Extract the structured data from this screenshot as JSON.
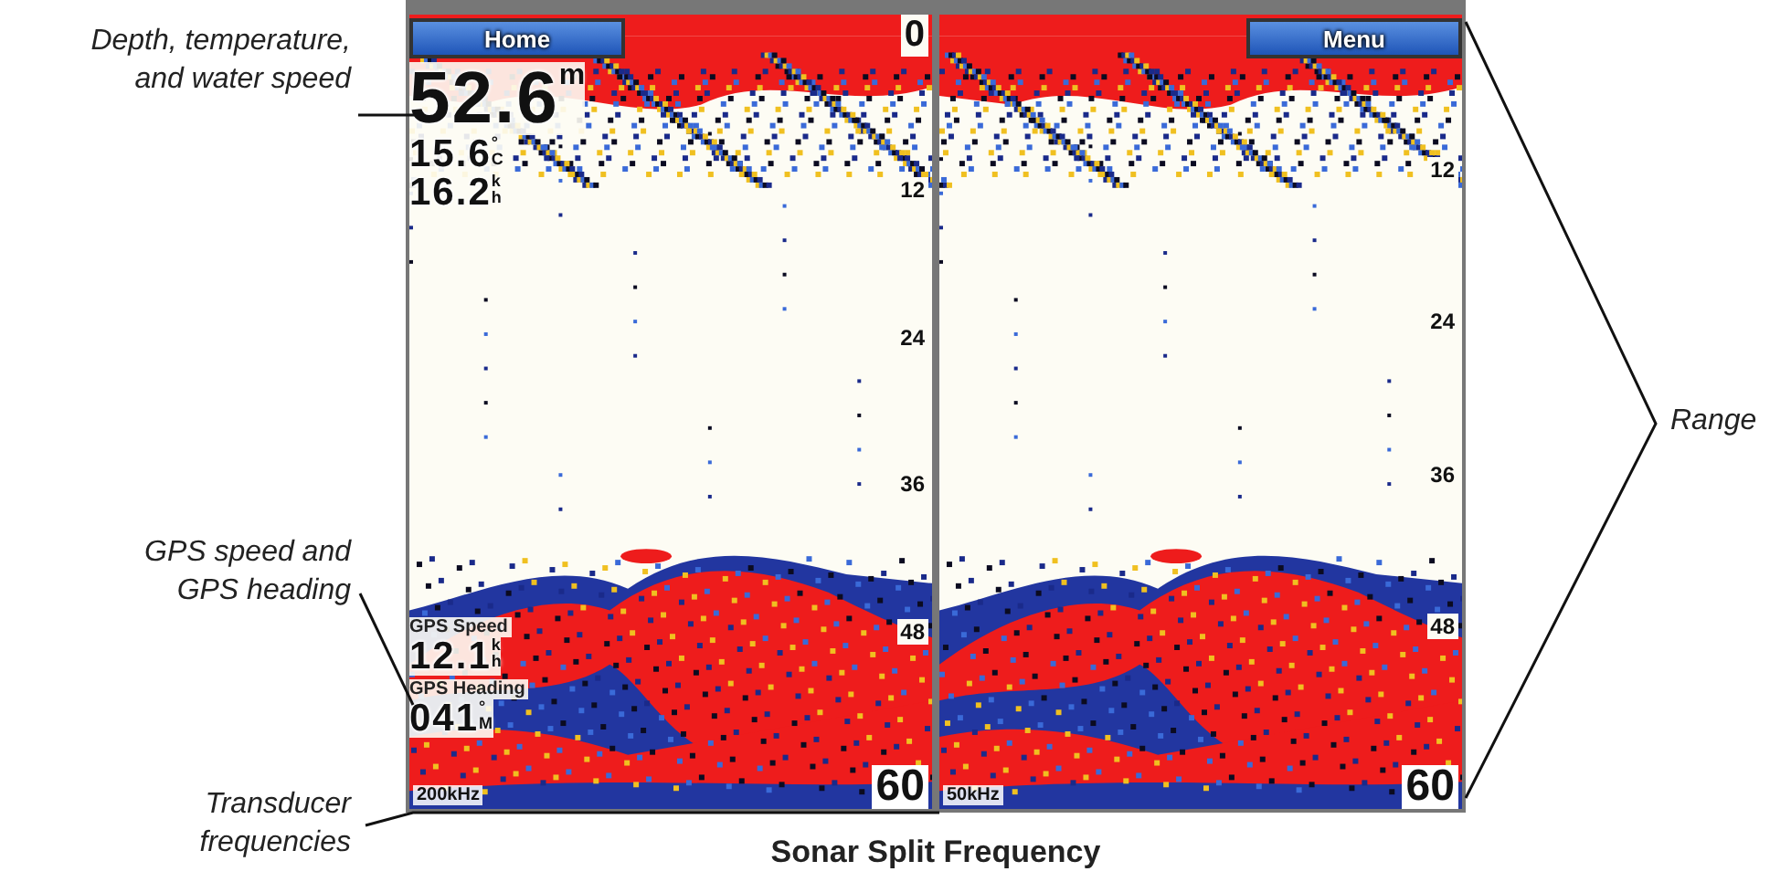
{
  "callouts": {
    "left": [
      {
        "text": "Depth, temperature, and water speed"
      },
      {
        "text": "GPS speed and GPS heading"
      },
      {
        "text": "Transducer frequencies"
      }
    ],
    "right": [
      {
        "text": "Range"
      }
    ]
  },
  "screen": {
    "panes": [
      {
        "button": {
          "label": "Home"
        },
        "scale": [
          "0",
          "12",
          "24",
          "36",
          "48",
          "60"
        ],
        "frequency": "200kHz",
        "top_readouts": [
          {
            "kind": "depth",
            "value": "52.6",
            "unit": [
              "m"
            ]
          },
          {
            "kind": "stat",
            "value": "15.6",
            "unit": [
              "°",
              "C"
            ]
          },
          {
            "kind": "stat",
            "value": "16.2",
            "unit": [
              "k",
              "h"
            ]
          }
        ],
        "bottom_readouts": [
          {
            "label": "GPS Speed",
            "value": "12.1",
            "unit": [
              "k",
              "h"
            ]
          },
          {
            "label": "GPS Heading",
            "value": "041",
            "unit": [
              "°",
              "M"
            ]
          }
        ]
      },
      {
        "button": {
          "label": "Menu"
        },
        "scale": [
          "12",
          "24",
          "36",
          "48",
          "60"
        ],
        "frequency": "50kHz"
      }
    ]
  },
  "caption": "Sonar Split Frequency"
}
